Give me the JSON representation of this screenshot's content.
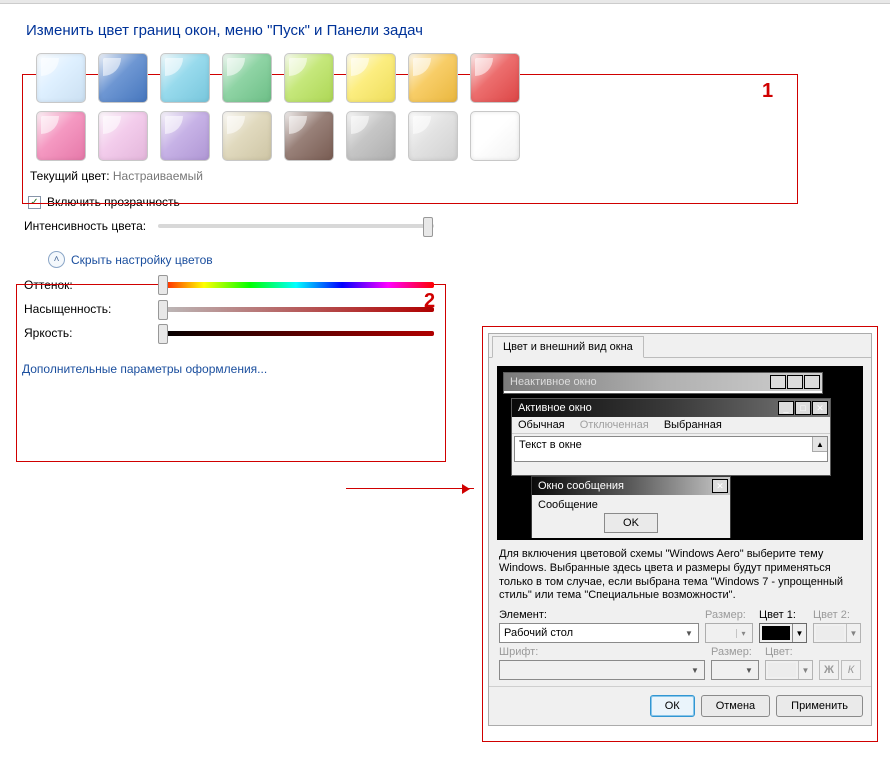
{
  "title": "Изменить цвет границ окон, меню \"Пуск\" и Панели задач",
  "annotations": {
    "one": "1",
    "two": "2"
  },
  "swatches_row1": [
    "#d6ecff",
    "#4a7dc8",
    "#7ed1e8",
    "#73c98e",
    "#b7e25a",
    "#fbe960",
    "#f6c142",
    "#e84a4a"
  ],
  "swatches_row2": [
    "#f27fb2",
    "#f0c0e7",
    "#b99fe0",
    "#d9d0ae",
    "#7f6157",
    "#b8b8b8",
    "#dcdcdc",
    "#ffffff"
  ],
  "current_color_label": "Текущий цвет:",
  "current_color_value": "Настраиваемый",
  "transparency_label": "Включить прозрачность",
  "transparency_checked": true,
  "intensity_label": "Интенсивность цвета:",
  "toggle_label": "Скрыть настройку цветов",
  "hue_label": "Оттенок:",
  "sat_label": "Насыщенность:",
  "bri_label": "Яркость:",
  "advanced_link": "Дополнительные параметры оформления...",
  "dialog": {
    "tab": "Цвет и внешний вид окна",
    "inactive_title": "Неактивное окно",
    "active_title": "Активное окно",
    "menu_normal": "Обычная",
    "menu_disabled": "Отключенная",
    "menu_selected": "Выбранная",
    "text_in_window": "Текст в окне",
    "msg_title": "Окно сообщения",
    "msg_body": "Сообщение",
    "ok_small": "OK",
    "note": "Для включения цветовой схемы \"Windows Aero\" выберите тему Windows.  Выбранные здесь цвета и размеры будут применяться только в том случае, если выбрана тема \"Windows 7 - упрощенный стиль\" или тема \"Специальные возможности\".",
    "element_label": "Элемент:",
    "element_value": "Рабочий стол",
    "size_label": "Размер:",
    "color1_label": "Цвет 1:",
    "color2_label": "Цвет 2:",
    "font_label": "Шрифт:",
    "color_label": "Цвет:",
    "bold": "Ж",
    "italic": "К",
    "btn_ok": "ОК",
    "btn_cancel": "Отмена",
    "btn_apply": "Применить"
  }
}
